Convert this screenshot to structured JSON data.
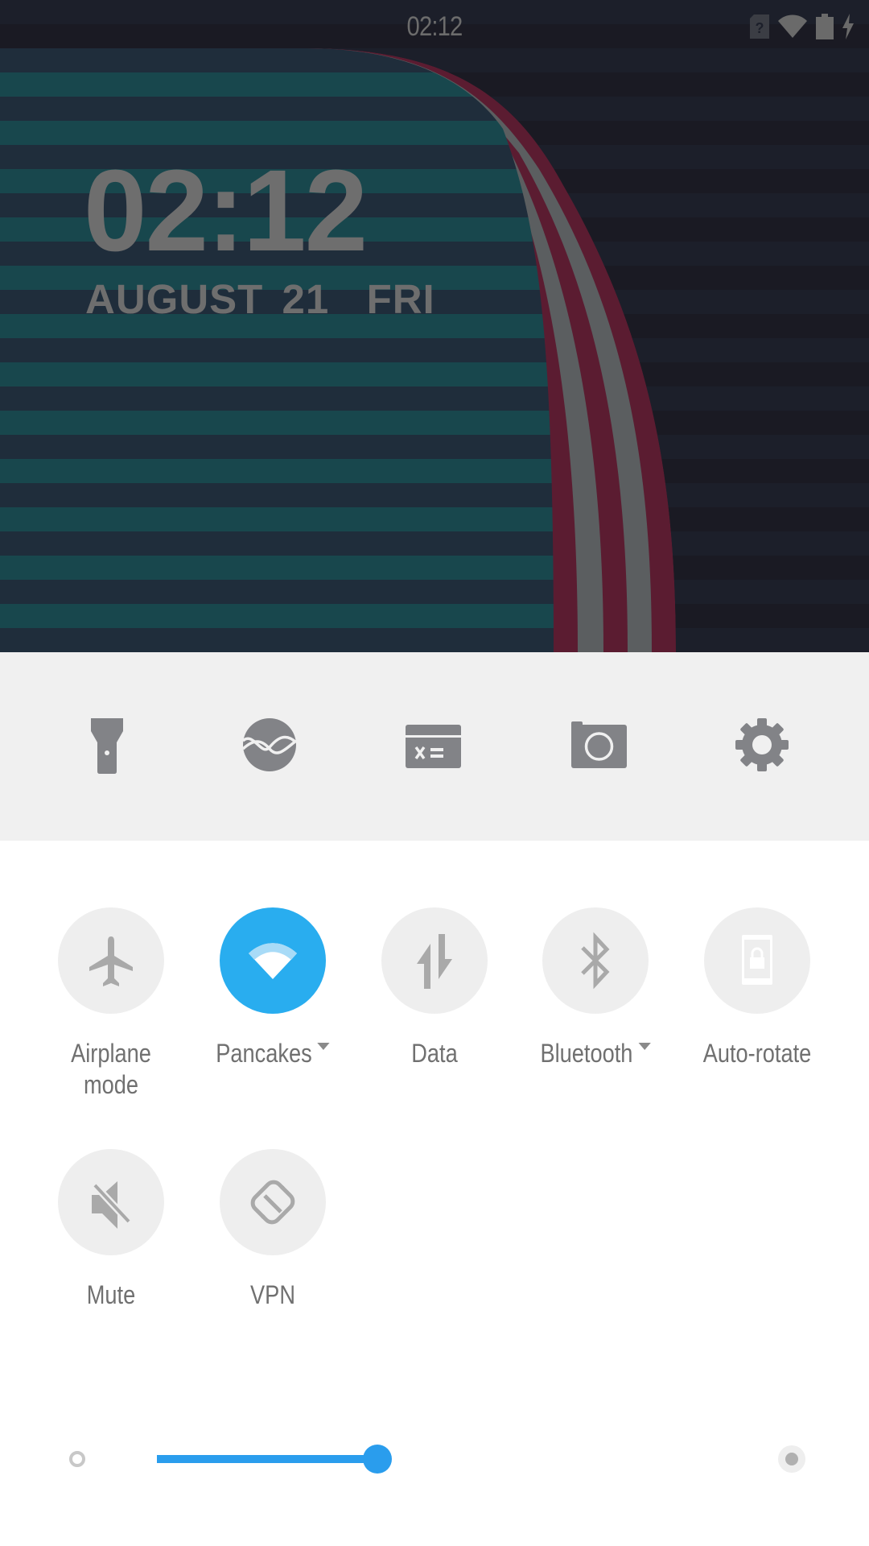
{
  "status_bar": {
    "time": "02:12",
    "icons": [
      "sim-unknown-icon",
      "wifi-icon",
      "battery-icon",
      "charging-icon"
    ]
  },
  "lockscreen": {
    "clock": "02:12",
    "date": "AUGUST 21  FRI"
  },
  "colors": {
    "accent": "#29adef",
    "slider": "#2a9ded",
    "tile_bg": "#eeeeee",
    "icon_gray": "#828387",
    "label_gray": "#707070",
    "wall_bg_a": "#1c1f2a",
    "wall_bg_b": "#1a1a23",
    "wall_teal_a": "#1f2d3b",
    "wall_teal_b": "#18474d",
    "wall_maroon": "#5b1c31",
    "wall_gray": "#5b5e60"
  },
  "shortcuts": [
    {
      "id": "flashlight",
      "icon": "flashlight-icon"
    },
    {
      "id": "music",
      "icon": "music-wave-icon"
    },
    {
      "id": "calculator",
      "icon": "calculator-icon"
    },
    {
      "id": "camera",
      "icon": "camera-icon"
    },
    {
      "id": "settings",
      "icon": "settings-gear-icon"
    }
  ],
  "tiles": [
    {
      "id": "airplane",
      "label": "Airplane\nmode",
      "line1": "Airplane",
      "line2": "mode",
      "icon": "airplane-icon",
      "active": false,
      "dropdown": false
    },
    {
      "id": "wifi",
      "label": "Pancakes",
      "line1": "Pancakes",
      "line2": "",
      "icon": "wifi-icon",
      "active": true,
      "dropdown": true
    },
    {
      "id": "data",
      "label": "Data",
      "line1": "Data",
      "line2": "",
      "icon": "data-arrows-icon",
      "active": false,
      "dropdown": false
    },
    {
      "id": "bluetooth",
      "label": "Bluetooth",
      "line1": "Bluetooth",
      "line2": "",
      "icon": "bluetooth-icon",
      "active": false,
      "dropdown": true
    },
    {
      "id": "autorotate",
      "label": "Auto-rotate",
      "line1": "Auto-rotate",
      "line2": "",
      "icon": "rotation-lock-icon",
      "active": false,
      "dropdown": false
    },
    {
      "id": "mute",
      "label": "Mute",
      "line1": "Mute",
      "line2": "",
      "icon": "mute-icon",
      "active": false,
      "dropdown": false
    },
    {
      "id": "vpn",
      "label": "VPN",
      "line1": "VPN",
      "line2": "",
      "icon": "vpn-icon",
      "active": false,
      "dropdown": false
    }
  ],
  "brightness": {
    "level": 0.37,
    "auto": false
  }
}
